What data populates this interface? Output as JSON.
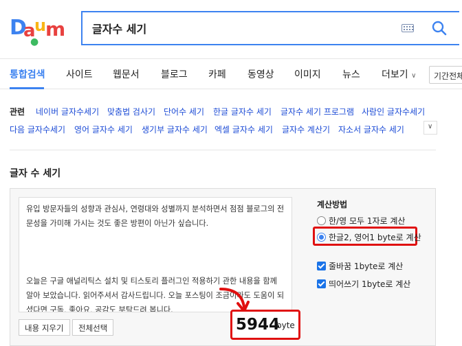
{
  "logo": {
    "text": "Daum"
  },
  "search": {
    "query": "글자수 세기"
  },
  "tabs": [
    {
      "label": "통합검색"
    },
    {
      "label": "사이트"
    },
    {
      "label": "웹문서"
    },
    {
      "label": "블로그"
    },
    {
      "label": "카페"
    },
    {
      "label": "동영상"
    },
    {
      "label": "이미지"
    },
    {
      "label": "뉴스"
    },
    {
      "label": "더보기"
    }
  ],
  "period_button": "기간전체",
  "related": {
    "label": "관련",
    "links": [
      "네이버 글자수세기",
      "맞춤법 검사기",
      "단어수 세기",
      "한글 글자수 세기",
      "글자수 세기 프로그램",
      "사람인 글자수세기",
      "다음 글자수세기",
      "영어 글자수 세기",
      "생기부 글자수 세기",
      "엑셀 글자수 세기",
      "글자수 계산기",
      "자소서 글자수 세기"
    ]
  },
  "tool": {
    "title": "글자 수 세기",
    "text_lines": [
      "유입 방문자들의 성향과 관심사, 연령대와 성별까지 분석하면서 점점 블로그의 전",
      "문성을 가미해 가시는 것도 좋은 방편이 아닌가 싶습니다.",
      "",
      "",
      "",
      "오늘은 구글 애널리틱스 설치 및 티스토리 플러그인 적용하기 관한 내용을 함께",
      "알아 보았습니다. 읽어주셔서 감사드립니다. 오늘 포스팅이 조금이라도 도움이 되",
      "셨다면 구독, 좋아요, 공감도 부탁드려 봅니다."
    ],
    "clear_button": "내용 지우기",
    "select_all_button": "전체선택",
    "count": "5944",
    "unit": "byte",
    "calc_title": "계산방법",
    "radio_option_1": "한/영 모두 1자로 계산",
    "radio_option_2": "한글2, 영어1 byte로 계산",
    "radio_selected": 2,
    "checkbox_1": "줄바꿈 1byte로 계산",
    "checkbox_2": "띄어쓰기 1byte로 계산"
  }
}
